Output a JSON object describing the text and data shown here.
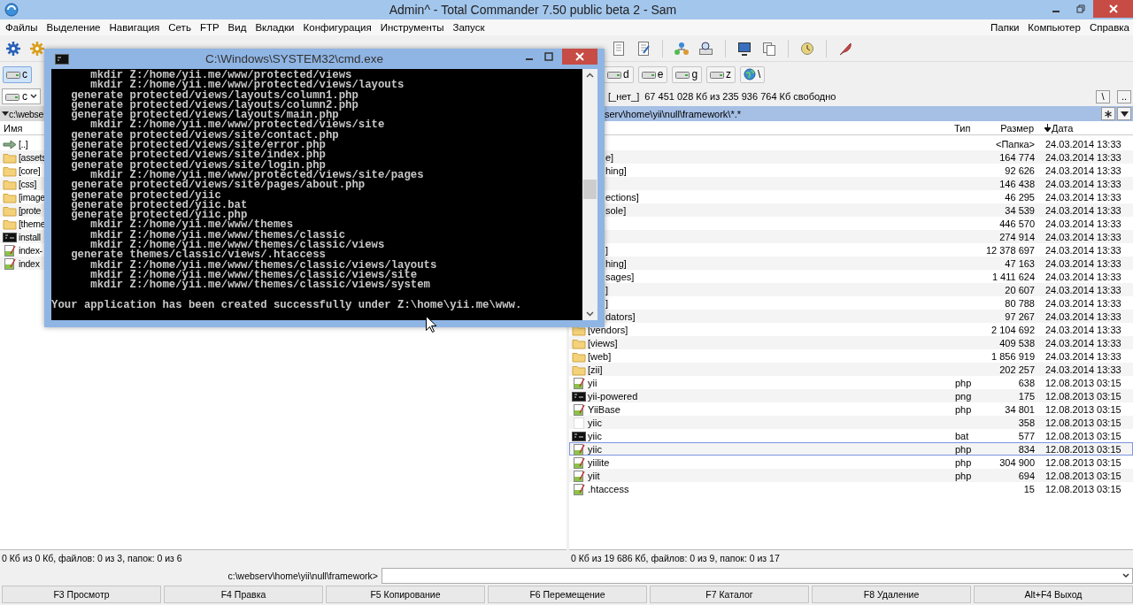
{
  "window": {
    "title": "Admin^ - Total Commander 7.50 public beta 2 - Sam"
  },
  "menu": {
    "left": [
      "Файлы",
      "Выделение",
      "Навигация",
      "Сеть",
      "FTP",
      "Вид",
      "Вкладки",
      "Конфигурация",
      "Инструменты",
      "Запуск"
    ],
    "right": [
      "Папки",
      "Компьютер",
      "Справка"
    ]
  },
  "drive_buttons": {
    "left": [
      {
        "label": "c",
        "kind": "disk",
        "selected": true
      }
    ],
    "right": [
      {
        "label": "d",
        "kind": "disk",
        "selected": false
      },
      {
        "label": "e",
        "kind": "disk",
        "selected": false
      },
      {
        "label": "g",
        "kind": "disk",
        "selected": false
      },
      {
        "label": "z",
        "kind": "disk",
        "selected": false
      },
      {
        "label": "\\",
        "kind": "network",
        "selected": false
      }
    ]
  },
  "left_panel": {
    "drive": "c",
    "path": "c:\\webse",
    "columns": [
      "Имя"
    ],
    "rows": [
      {
        "kind": "parent",
        "name": "[..]",
        "selected": false
      },
      {
        "kind": "folder",
        "name": "[assets",
        "selected": false
      },
      {
        "kind": "folder",
        "name": "[core]",
        "selected": false
      },
      {
        "kind": "folder",
        "name": "[css]",
        "selected": false
      },
      {
        "kind": "folder",
        "name": "[image",
        "selected": false
      },
      {
        "kind": "folder",
        "name": "[prote",
        "selected": false
      },
      {
        "kind": "folder",
        "name": "[theme",
        "selected": false
      },
      {
        "kind": "console",
        "name": "install",
        "selected": false
      },
      {
        "kind": "script",
        "name": "index-",
        "selected": false
      },
      {
        "kind": "script",
        "name": "index",
        "selected": false
      }
    ],
    "status": "0 Кб из 0 Кб, файлов: 0 из 3, папок: 0 из 6"
  },
  "right_panel": {
    "drive_info": "[_нет_]",
    "free_space": "67 451 028 Кб из 235 936 764 Кб свободно",
    "root_button": "\\",
    "up_button": "..",
    "path": "serv\\home\\yii\\null\\framework\\*.*",
    "columns": {
      "type": "Тип",
      "size": "Размер",
      "date": "Дата"
    },
    "rows": [
      {
        "kind": "hidden",
        "size": "<Папка>",
        "date": "24.03.2014 13:33",
        "selected": false
      },
      {
        "kind": "hidden",
        "name": "e]",
        "size": "164 774",
        "date": "24.03.2014 13:33",
        "selected": false
      },
      {
        "kind": "hidden",
        "name": "hing]",
        "size": "92 626",
        "date": "24.03.2014 13:33",
        "selected": false
      },
      {
        "kind": "hidden",
        "size": "146 438",
        "date": "24.03.2014 13:33",
        "selected": false
      },
      {
        "kind": "hidden",
        "name": "ections]",
        "size": "46 295",
        "date": "24.03.2014 13:33",
        "selected": false
      },
      {
        "kind": "hidden",
        "name": "sole]",
        "size": "34 539",
        "date": "24.03.2014 13:33",
        "selected": false
      },
      {
        "kind": "hidden",
        "size": "446 570",
        "date": "24.03.2014 13:33",
        "selected": false
      },
      {
        "kind": "hidden",
        "size": "274 914",
        "date": "24.03.2014 13:33",
        "selected": false
      },
      {
        "kind": "hidden",
        "name": "]",
        "size": "12 378 697",
        "date": "24.03.2014 13:33",
        "selected": false
      },
      {
        "kind": "hidden",
        "name": "hing]",
        "size": "47 163",
        "date": "24.03.2014 13:33",
        "selected": false
      },
      {
        "kind": "hidden",
        "name": "sages]",
        "size": "1 411 624",
        "date": "24.03.2014 13:33",
        "selected": false
      },
      {
        "kind": "hidden",
        "name": "]",
        "size": "20 607",
        "date": "24.03.2014 13:33",
        "selected": false
      },
      {
        "kind": "hidden",
        "name": "]",
        "size": "80 788",
        "date": "24.03.2014 13:33",
        "selected": false
      },
      {
        "kind": "hidden",
        "name": "dators]",
        "size": "97 267",
        "date": "24.03.2014 13:33",
        "selected": false
      },
      {
        "kind": "folder",
        "name": "[vendors]",
        "size": "2 104 692",
        "date": "24.03.2014 13:33",
        "selected": false
      },
      {
        "kind": "folder",
        "name": "[views]",
        "size": "409 538",
        "date": "24.03.2014 13:33",
        "selected": false
      },
      {
        "kind": "folder",
        "name": "[web]",
        "size": "1 856 919",
        "date": "24.03.2014 13:33",
        "selected": false
      },
      {
        "kind": "folder",
        "name": "[zii]",
        "size": "202 257",
        "date": "24.03.2014 13:33",
        "selected": false
      },
      {
        "kind": "script",
        "name": "yii",
        "type": "php",
        "size": "638",
        "date": "12.08.2013 03:15",
        "selected": false
      },
      {
        "kind": "console",
        "name": "yii-powered",
        "type": "png",
        "size": "175",
        "date": "12.08.2013 03:15",
        "selected": false
      },
      {
        "kind": "script",
        "name": "YiiBase",
        "type": "php",
        "size": "34 801",
        "date": "12.08.2013 03:15",
        "selected": false
      },
      {
        "kind": "blank",
        "name": "yiic",
        "size": "358",
        "date": "12.08.2013 03:15",
        "selected": false
      },
      {
        "kind": "console",
        "name": "yiic",
        "type": "bat",
        "size": "577",
        "date": "12.08.2013 03:15",
        "selected": false
      },
      {
        "kind": "script",
        "name": "yiic",
        "type": "php",
        "size": "834",
        "date": "12.08.2013 03:15",
        "selected": true
      },
      {
        "kind": "script",
        "name": "yiilite",
        "type": "php",
        "size": "304 900",
        "date": "12.08.2013 03:15",
        "selected": false
      },
      {
        "kind": "script",
        "name": "yiit",
        "type": "php",
        "size": "694",
        "date": "12.08.2013 03:15",
        "selected": false
      },
      {
        "kind": "script",
        "name": ".htaccess",
        "size": "15",
        "date": "12.08.2013 03:15",
        "selected": false
      }
    ],
    "status": "0 Кб из 19 686 Кб, файлов: 0 из 9, папок: 0 из 17"
  },
  "command_line": {
    "prompt": "c:\\webserv\\home\\yii\\null\\framework>"
  },
  "function_keys": [
    "F3 Просмотр",
    "F4 Правка",
    "F5 Копирование",
    "F6 Перемещение",
    "F7 Каталог",
    "F8 Удаление",
    "Alt+F4 Выход"
  ],
  "console_window": {
    "title": "C:\\Windows\\SYSTEM32\\cmd.exe",
    "lines": [
      {
        "verb": "mkdir",
        "path": "Z:/home/yii.me/www/protected/views"
      },
      {
        "verb": "mkdir",
        "path": "Z:/home/yii.me/www/protected/views/layouts"
      },
      {
        "verb": "generate",
        "path": "protected/views/layouts/column1.php"
      },
      {
        "verb": "generate",
        "path": "protected/views/layouts/column2.php"
      },
      {
        "verb": "generate",
        "path": "protected/views/layouts/main.php"
      },
      {
        "verb": "mkdir",
        "path": "Z:/home/yii.me/www/protected/views/site"
      },
      {
        "verb": "generate",
        "path": "protected/views/site/contact.php"
      },
      {
        "verb": "generate",
        "path": "protected/views/site/error.php"
      },
      {
        "verb": "generate",
        "path": "protected/views/site/index.php"
      },
      {
        "verb": "generate",
        "path": "protected/views/site/login.php"
      },
      {
        "verb": "mkdir",
        "path": "Z:/home/yii.me/www/protected/views/site/pages"
      },
      {
        "verb": "generate",
        "path": "protected/views/site/pages/about.php"
      },
      {
        "verb": "generate",
        "path": "protected/yiic"
      },
      {
        "verb": "generate",
        "path": "protected/yiic.bat"
      },
      {
        "verb": "generate",
        "path": "protected/yiic.php"
      },
      {
        "verb": "mkdir",
        "path": "Z:/home/yii.me/www/themes"
      },
      {
        "verb": "mkdir",
        "path": "Z:/home/yii.me/www/themes/classic"
      },
      {
        "verb": "mkdir",
        "path": "Z:/home/yii.me/www/themes/classic/views"
      },
      {
        "verb": "generate",
        "path": "themes/classic/views/.htaccess"
      },
      {
        "verb": "mkdir",
        "path": "Z:/home/yii.me/www/themes/classic/views/layouts"
      },
      {
        "verb": "mkdir",
        "path": "Z:/home/yii.me/www/themes/classic/views/site"
      },
      {
        "verb": "mkdir",
        "path": "Z:/home/yii.me/www/themes/classic/views/system"
      }
    ],
    "message": "Your application has been created successfully under Z:\\home\\yii.me\\www."
  }
}
